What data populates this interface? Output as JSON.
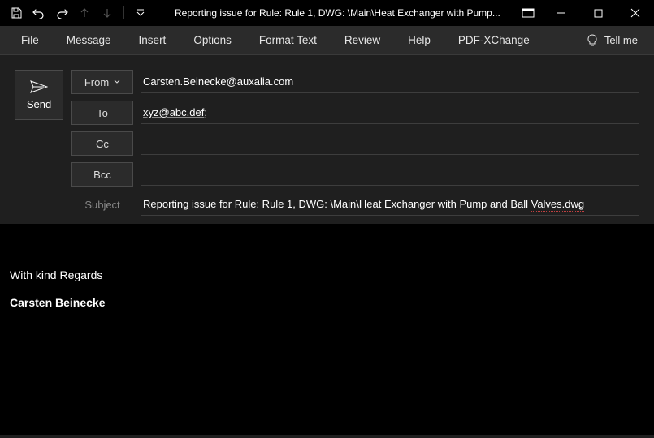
{
  "titlebar": {
    "title": "Reporting issue for Rule: Rule 1, DWG: \\Main\\Heat Exchanger with Pump..."
  },
  "menu": {
    "items": [
      "File",
      "Message",
      "Insert",
      "Options",
      "Format Text",
      "Review",
      "Help",
      "PDF-XChange"
    ],
    "tell_me": "Tell me"
  },
  "send": {
    "label": "Send"
  },
  "fields": {
    "from_label": "From",
    "from_value": "Carsten.Beinecke@auxalia.com",
    "to_label": "To",
    "to_value": "xyz@abc.def",
    "to_suffix": ";",
    "cc_label": "Cc",
    "cc_value": "",
    "bcc_label": "Bcc",
    "bcc_value": ""
  },
  "subject": {
    "label": "Subject",
    "value_prefix": "Reporting issue for Rule: Rule 1, DWG: \\Main\\Heat Exchanger with Pump and Ball ",
    "value_squiggle": "Valves.dwg"
  },
  "body": {
    "regards": "With kind Regards",
    "signature_name": "Carsten Beinecke"
  }
}
